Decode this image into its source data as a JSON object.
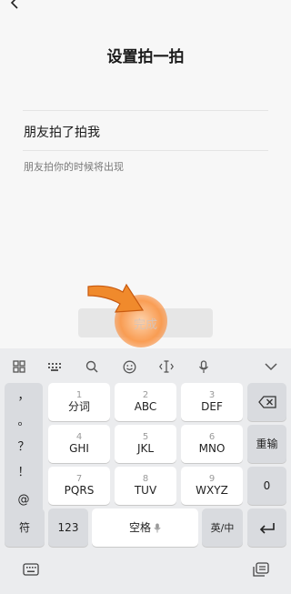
{
  "page": {
    "title": "设置拍一拍",
    "pat_text": "朋友拍了拍我",
    "hint": "朋友拍你的时候将出现",
    "done_label": "完成"
  },
  "keyboard": {
    "toolbar_icons": [
      "grid-icon",
      "keyboard-icon",
      "search-icon",
      "emoji-icon",
      "cursor-icon",
      "mic-icon",
      "collapse-icon"
    ],
    "punctuation": [
      "，",
      "。",
      "？",
      "！",
      "@"
    ],
    "keys": {
      "k1": {
        "num": "1",
        "label": "分词"
      },
      "k2": {
        "num": "2",
        "label": "ABC"
      },
      "k3": {
        "num": "3",
        "label": "DEF"
      },
      "k4": {
        "num": "4",
        "label": "GHI"
      },
      "k5": {
        "num": "5",
        "label": "JKL"
      },
      "k6": {
        "num": "6",
        "label": "MNO"
      },
      "k7": {
        "num": "7",
        "label": "PQRS"
      },
      "k8": {
        "num": "8",
        "label": "TUV"
      },
      "k9": {
        "num": "9",
        "label": "WXYZ"
      }
    },
    "reenter": "重输",
    "zero": "0",
    "symbols": "符",
    "numbers": "123",
    "space": "空格",
    "lang": "英/中"
  },
  "colors": {
    "accent_orange": "#f08a2c"
  }
}
